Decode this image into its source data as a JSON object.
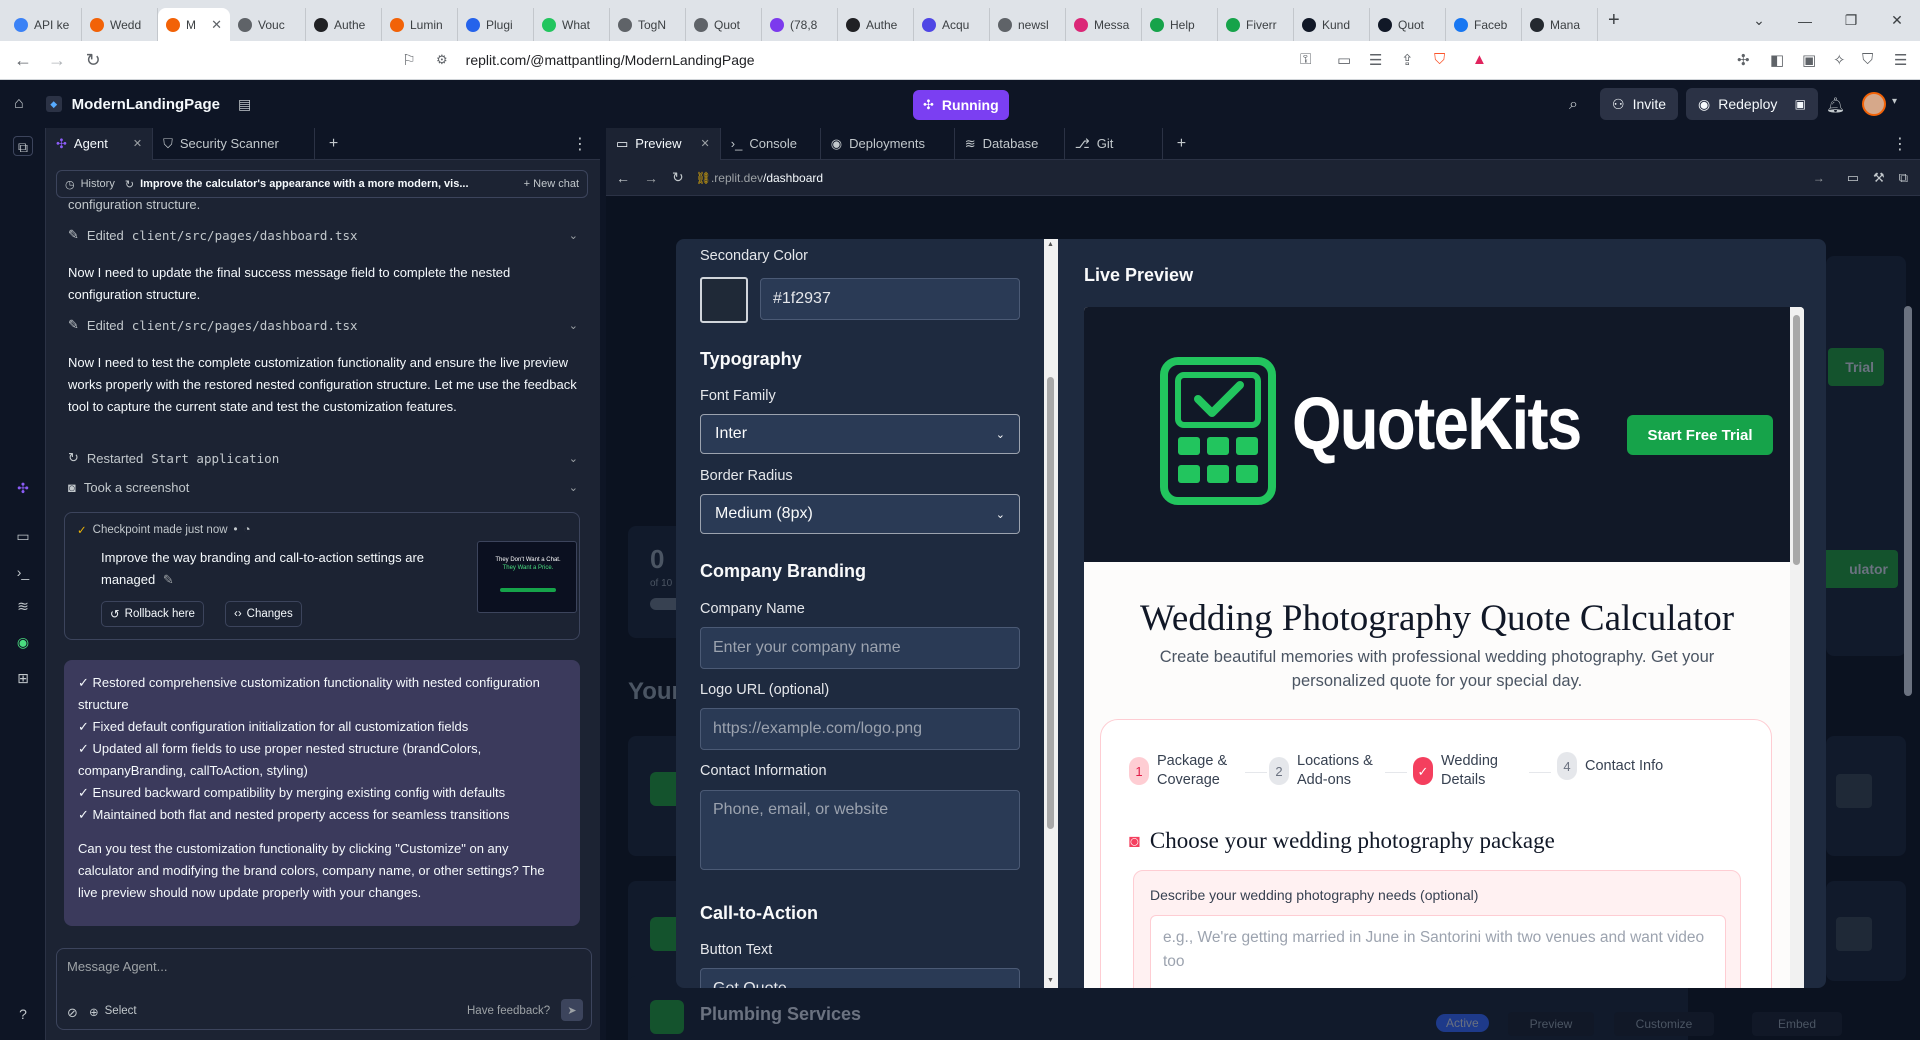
{
  "browser": {
    "tabs": [
      {
        "label": "API ke",
        "color": "#3b82f6"
      },
      {
        "label": "Wedd",
        "color": "#f26207"
      },
      {
        "label": "M",
        "color": "#f26207",
        "active": true
      },
      {
        "label": "Vouc",
        "color": "#5f6368"
      },
      {
        "label": "Authe",
        "color": "#202124"
      },
      {
        "label": "Lumin",
        "color": "#f26207"
      },
      {
        "label": "Plugi",
        "color": "#2563eb"
      },
      {
        "label": "What",
        "color": "#22c55e"
      },
      {
        "label": "TogN",
        "color": "#5f6368"
      },
      {
        "label": "Quot",
        "color": "#5f6368"
      },
      {
        "label": "(78,8",
        "color": "#7c3aed"
      },
      {
        "label": "Authe",
        "color": "#202124"
      },
      {
        "label": "Acqu",
        "color": "#4f46e5"
      },
      {
        "label": "newsl",
        "color": "#5f6368"
      },
      {
        "label": "Messa",
        "color": "#db2777"
      },
      {
        "label": "Help",
        "color": "#16a34a"
      },
      {
        "label": "Fiverr",
        "color": "#16a34a"
      },
      {
        "label": "Kund",
        "color": "#111827"
      },
      {
        "label": "Quot",
        "color": "#111827"
      },
      {
        "label": "Faceb",
        "color": "#1877f2"
      },
      {
        "label": "Mana",
        "color": "#24292f"
      }
    ],
    "url": "replit.com/@mattpantling/ModernLandingPage"
  },
  "replit": {
    "project_name": "ModernLandingPage",
    "run_label": "Running",
    "invite_label": "Invite",
    "redeploy_label": "Redeploy"
  },
  "agent": {
    "tabs": [
      "Agent",
      "Security Scanner"
    ],
    "history_label": "History",
    "history_title": "Improve the calculator's appearance with a more modern, vis...",
    "new_chat_label": "New chat",
    "cut_line": "configuration structure.",
    "event1_label": "Edited",
    "event1_file": "client/src/pages/dashboard.tsx",
    "msg1": "Now I need to update the final success message field to complete the nested configuration structure.",
    "event2_label": "Edited",
    "event2_file": "client/src/pages/dashboard.tsx",
    "msg2": "Now I need to test the complete customization functionality and ensure the live preview works properly with the restored nested configuration structure. Let me use the feedback tool to capture the current state and test the customization features.",
    "event3_label": "Restarted",
    "event3_code": "Start application",
    "event4_label": "Took a screenshot",
    "checkpoint": {
      "header": "Checkpoint made just now",
      "dot": "•",
      "description": "Improve the way branding and call-to-action settings are managed",
      "rollback_label": "Rollback here",
      "changes_label": "Changes",
      "thumb_line1": "They Don't Want a Chat.",
      "thumb_line2": "They Want a Price."
    },
    "summary_items": [
      "✓ Restored comprehensive customization functionality with nested configuration structure",
      "✓ Fixed default configuration initialization for all customization fields",
      "✓ Updated all form fields to use proper nested structure (brandColors, companyBranding, callToAction, styling)",
      "✓ Ensured backward compatibility by merging existing config with defaults",
      "✓ Maintained both flat and nested property access for seamless transitions"
    ],
    "summary_question": "Can you test the customization functionality by clicking \"Customize\" on any calculator and modifying the brand colors, company name, or other settings? The live preview should now update properly with your changes.",
    "composer_placeholder": "Message Agent...",
    "select_label": "Select",
    "feedback_label": "Have feedback?"
  },
  "workspace": {
    "tabs": [
      "Preview",
      "Console",
      "Deployments",
      "Database",
      "Git"
    ],
    "url_prefix": ".replit.dev",
    "url_path": "/dashboard"
  },
  "dashboard_bg": {
    "stat_value": "0",
    "stat_caption": "of 10",
    "section_title": "Your",
    "trial_btn": "Trial",
    "calc_btn": "ulator",
    "card3_title": "Plumbing Services",
    "status_badge": "Active",
    "preview_btn": "Preview",
    "customize_btn": "Customize",
    "embed_btn": "Embed"
  },
  "settings": {
    "secondary_color_label": "Secondary Color",
    "secondary_color_value": "#1f2937",
    "typography_heading": "Typography",
    "font_family_label": "Font Family",
    "font_family_value": "Inter",
    "border_radius_label": "Border Radius",
    "border_radius_value": "Medium (8px)",
    "company_branding_heading": "Company Branding",
    "company_name_label": "Company Name",
    "company_name_placeholder": "Enter your company name",
    "logo_url_label": "Logo URL (optional)",
    "logo_url_placeholder": "https://example.com/logo.png",
    "contact_label": "Contact Information",
    "contact_placeholder": "Phone, email, or website",
    "cta_heading": "Call-to-Action",
    "button_text_label": "Button Text",
    "button_text_value": "Get Quote"
  },
  "live_preview": {
    "title": "Live Preview",
    "brand_name": "QuoteKits",
    "cta_label": "Start Free Trial",
    "heading": "Wedding Photography Quote Calculator",
    "subheading": "Create beautiful memories with professional wedding photography. Get your personalized quote for your special day.",
    "steps": [
      {
        "num": "1",
        "label": "Package & Coverage"
      },
      {
        "num": "2",
        "label": "Locations & Add-ons"
      },
      {
        "num": "✓",
        "label": "Wedding Details"
      },
      {
        "num": "4",
        "label": "Contact Info"
      }
    ],
    "package_heading": "Choose your wedding photography package",
    "needs_label": "Describe your wedding photography needs (optional)",
    "needs_placeholder": "e.g., We're getting married in June in Santorini with two venues and want video too"
  },
  "colors": {
    "accent_purple": "#7b3ff2",
    "brand_green": "#16a34a",
    "summary_bg": "#3b3a5c",
    "modal_bg": "#1e2a3f"
  }
}
